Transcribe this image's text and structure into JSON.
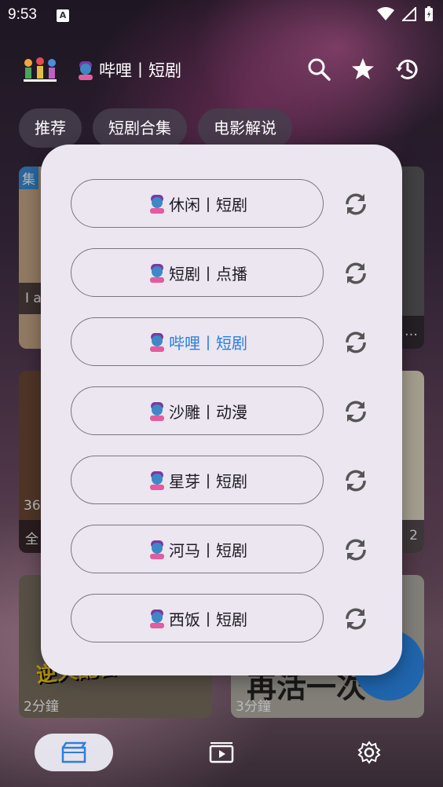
{
  "status_bar": {
    "time": "9:53",
    "notification_icon": "A"
  },
  "header": {
    "title": "哔哩丨短剧"
  },
  "tabs": [
    "推荐",
    "短剧合集",
    "电影解说"
  ],
  "cards": [
    {
      "badge": "集",
      "caption": "I a"
    },
    {
      "caption": "…"
    },
    {
      "duration": "36",
      "caption": "全"
    },
    {
      "caption": "2"
    },
    {
      "duration": "2分鐘",
      "overlay": "逆天配音"
    },
    {
      "duration": "3分鐘",
      "overlay": "再活一次"
    }
  ],
  "popup": {
    "sources": [
      {
        "label": "休闲丨短剧",
        "active": false
      },
      {
        "label": "短剧丨点播",
        "active": false
      },
      {
        "label": "哔哩丨短剧",
        "active": true
      },
      {
        "label": "沙雕丨动漫",
        "active": false
      },
      {
        "label": "星芽丨短剧",
        "active": false
      },
      {
        "label": "河马丨短剧",
        "active": false
      },
      {
        "label": "西饭丨短剧",
        "active": false
      }
    ]
  },
  "colors": {
    "accent": "#2b7fe0",
    "popup_bg": "#ebe6f0",
    "fab": "#2d8cf0"
  }
}
